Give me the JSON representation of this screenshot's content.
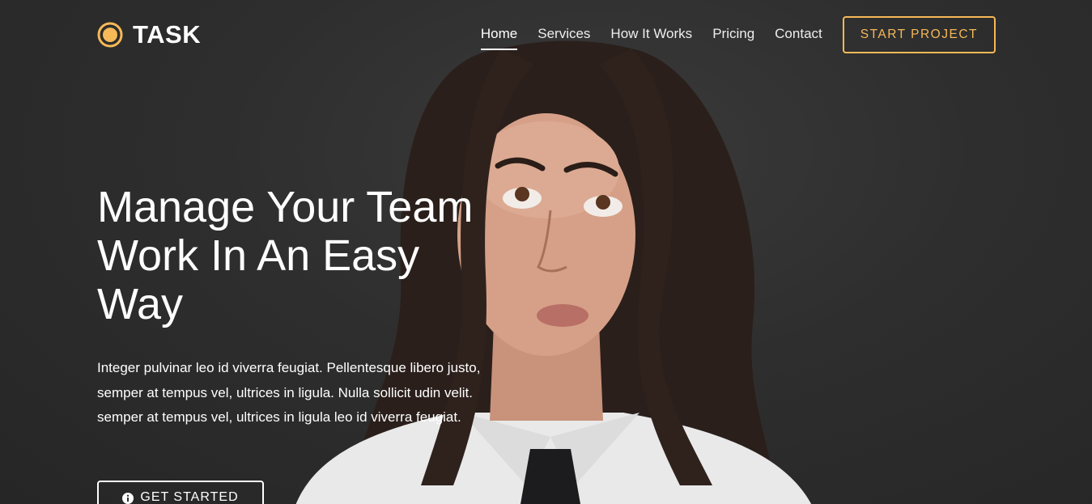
{
  "brand": {
    "name": "TASK",
    "logo_icon": "circle-logo-icon",
    "accent_color": "#f6b957"
  },
  "nav": {
    "items": [
      {
        "label": "Home",
        "active": true
      },
      {
        "label": "Services",
        "active": false
      },
      {
        "label": "How It Works",
        "active": false
      },
      {
        "label": "Pricing",
        "active": false
      },
      {
        "label": "Contact",
        "active": false
      }
    ],
    "cta_label": "START PROJECT"
  },
  "hero": {
    "headline_line1": "Manage Your Team",
    "headline_line2": "Work In An Easy",
    "headline_line3": "Way",
    "paragraph": "Integer pulvinar leo id viverra feugiat. Pellentesque libero justo, semper at tempus vel, ultrices in ligula. Nulla sollicit udin velit. semper at tempus vel, ultrices in ligula leo id viverra feugiat.",
    "cta_label": "GET STARTED",
    "cta_icon": "info-circle-icon",
    "background_color": "#2e2e2e"
  }
}
